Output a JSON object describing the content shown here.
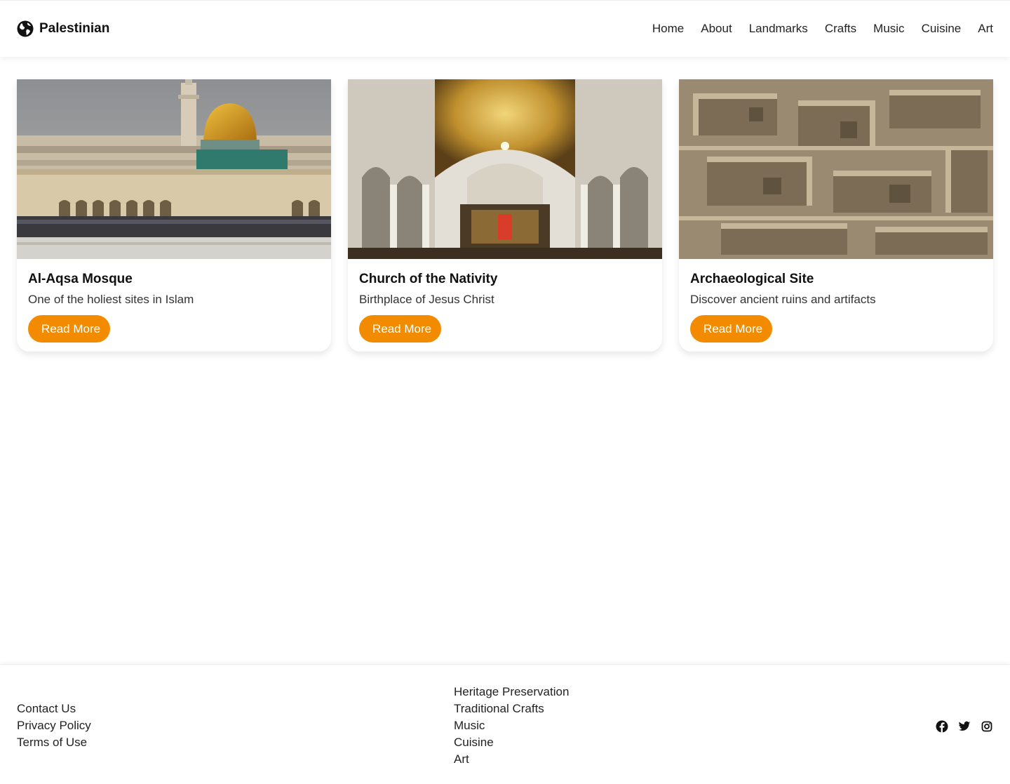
{
  "header": {
    "brand": "Palestinian",
    "brand_icon": "globe-icon",
    "nav": [
      "Home",
      "About",
      "Landmarks",
      "Crafts",
      "Music",
      "Cuisine",
      "Art"
    ]
  },
  "cards": [
    {
      "title": "Al-Aqsa Mosque",
      "description": "One of the holiest sites in Islam",
      "button": "Read More",
      "image": "mosque-photo"
    },
    {
      "title": "Church of the Nativity",
      "description": "Birthplace of Jesus Christ",
      "button": "Read More",
      "image": "church-interior-photo"
    },
    {
      "title": "Archaeological Site",
      "description": "Discover ancient ruins and artifacts",
      "button": "Read More",
      "image": "ruins-photo"
    }
  ],
  "footer": {
    "left_links": [
      "Contact Us",
      "Privacy Policy",
      "Terms of Use"
    ],
    "middle_links": [
      "Heritage Preservation",
      "Traditional Crafts",
      "Music",
      "Cuisine",
      "Art"
    ],
    "social": [
      "facebook-icon",
      "twitter-icon",
      "instagram-icon"
    ]
  },
  "colors": {
    "accent": "#f28b00",
    "text": "#111111",
    "background": "#ffffff"
  }
}
